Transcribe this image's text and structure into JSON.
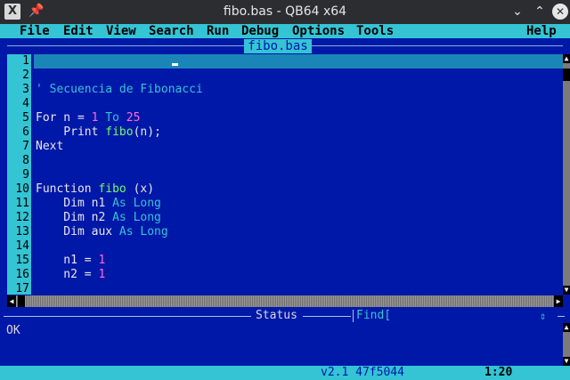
{
  "window": {
    "title": "fibo.bas - QB64 x64",
    "app_icon": "x-logo-icon",
    "pin_glyph": "★",
    "minimize_glyph": "⌄",
    "maximize_glyph": "⌃",
    "close_glyph": "✕"
  },
  "menu": {
    "file": "File",
    "edit": "Edit",
    "view": "View",
    "search": "Search",
    "run": "Run",
    "debug": "Debug",
    "options": "Options",
    "tools": "Tools",
    "help": "Help"
  },
  "editor": {
    "tab_title": "fibo.bas",
    "line_numbers": [
      "1",
      "2",
      "3",
      "4",
      "5",
      "6",
      "7",
      "8",
      "9",
      "10",
      "11",
      "12",
      "13",
      "14",
      "15",
      "16",
      "17"
    ],
    "lines": [
      [],
      [],
      [
        {
          "t": "' Secuencia de Fibonacci",
          "c": "cm"
        }
      ],
      [],
      [
        {
          "t": "For",
          "c": "tx"
        },
        {
          "t": " n = ",
          "c": "tx"
        },
        {
          "t": "1",
          "c": "num"
        },
        {
          "t": " To ",
          "c": "kw"
        },
        {
          "t": "25",
          "c": "num"
        }
      ],
      [
        {
          "t": "    Print ",
          "c": "tx"
        },
        {
          "t": "fibo",
          "c": "fn"
        },
        {
          "t": "(n);",
          "c": "tx"
        }
      ],
      [
        {
          "t": "Next",
          "c": "tx"
        }
      ],
      [],
      [],
      [
        {
          "t": "Function ",
          "c": "tx"
        },
        {
          "t": "fibo",
          "c": "fn"
        },
        {
          "t": " (x)",
          "c": "tx"
        }
      ],
      [
        {
          "t": "    Dim n1 ",
          "c": "tx"
        },
        {
          "t": "As Long",
          "c": "kw"
        }
      ],
      [
        {
          "t": "    Dim n2 ",
          "c": "tx"
        },
        {
          "t": "As Long",
          "c": "kw"
        }
      ],
      [
        {
          "t": "    Dim aux ",
          "c": "tx"
        },
        {
          "t": "As Long",
          "c": "kw"
        }
      ],
      [],
      [
        {
          "t": "    n1 = ",
          "c": "tx"
        },
        {
          "t": "1",
          "c": "num"
        }
      ],
      [
        {
          "t": "    n2 = ",
          "c": "tx"
        },
        {
          "t": "1",
          "c": "num"
        }
      ],
      []
    ]
  },
  "status": {
    "label": "Status",
    "find_label": "Find[",
    "find_arrows": "⇕",
    "output": "OK"
  },
  "statusbar": {
    "version": "v2.1 47f5044",
    "position": "1:20"
  },
  "colors": {
    "editor_bg": "#0018a8",
    "accent": "#34c4d4",
    "current_line": "#1a86b8",
    "number": "#ff6bd8",
    "function": "#6dff6d"
  }
}
